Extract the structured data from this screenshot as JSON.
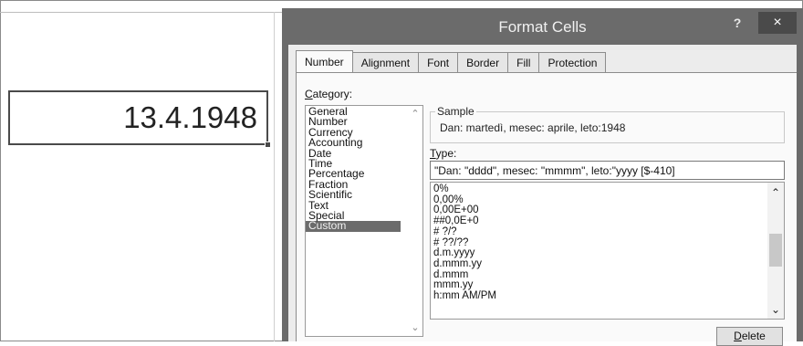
{
  "cell": {
    "value": "13.4.1948"
  },
  "dialog": {
    "title": "Format Cells",
    "help_label": "?",
    "close_label": "×",
    "tabs": [
      "Number",
      "Alignment",
      "Font",
      "Border",
      "Fill",
      "Protection"
    ],
    "active_tab": "Number",
    "category_label_first": "C",
    "category_label_rest": "ategory:",
    "categories": [
      "General",
      "Number",
      "Currency",
      "Accounting",
      "Date",
      "Time",
      "Percentage",
      "Fraction",
      "Scientific",
      "Text",
      "Special",
      "Custom"
    ],
    "selected_category": "Custom",
    "sample_label": "Sample",
    "sample_text": "Dan: martedì, mesec: aprile, leto:1948",
    "type_label_first": "T",
    "type_label_rest": "ype:",
    "type_value": "\"Dan: \"dddd\", mesec: \"mmmm\", leto:\"yyyy [$-410]",
    "formats": [
      "0%",
      "0,00%",
      "0,00E+00",
      "##0,0E+0",
      "# ?/?",
      "# ??/??",
      "d.m.yyyy",
      "d.mmm.yy",
      "d.mmm",
      "mmm.yy",
      "h:mm AM/PM"
    ],
    "delete_label_first": "D",
    "delete_label_rest": "elete",
    "icons": {
      "scroll_up": "chevron-up-icon",
      "scroll_down": "chevron-down-icon"
    }
  },
  "colors": {
    "title_bar": "#6b6b6b",
    "selection": "#6b6b6b",
    "close_button": "#4a4a4a"
  }
}
